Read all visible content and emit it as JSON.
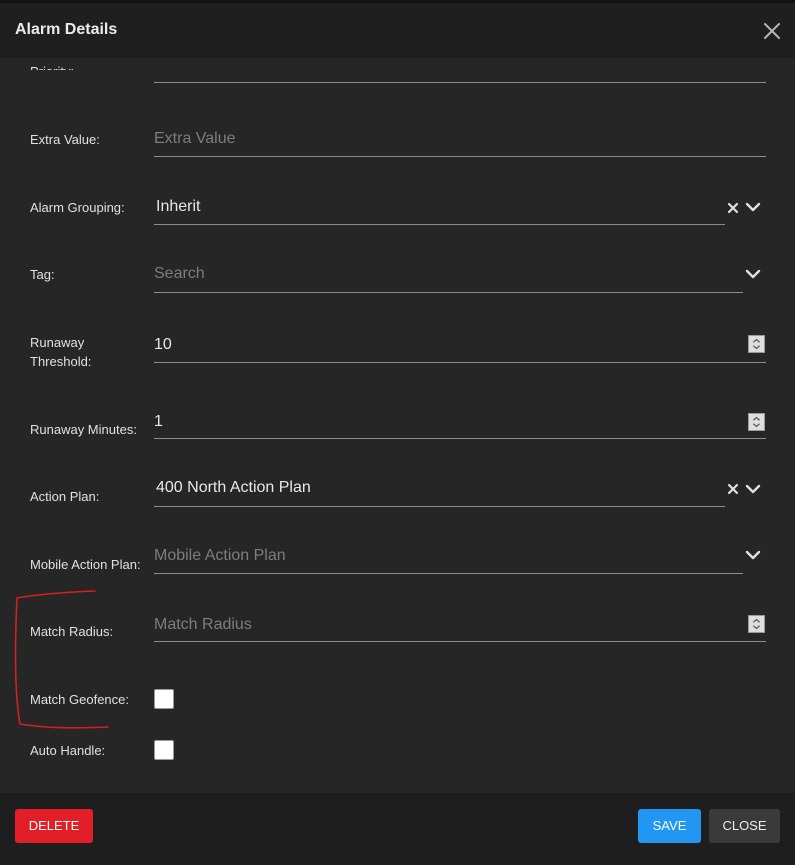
{
  "dialog": {
    "title": "Alarm Details",
    "partial_label": "Priority:"
  },
  "fields": {
    "extra_value": {
      "label": "Extra Value:",
      "placeholder": "Extra Value"
    },
    "alarm_grouping": {
      "label": "Alarm Grouping:",
      "value": "Inherit"
    },
    "tag": {
      "label": "Tag:",
      "placeholder": "Search"
    },
    "runaway_threshold": {
      "label_line1": "Runaway",
      "label_line2": "Threshold:",
      "value": "10"
    },
    "runaway_minutes": {
      "label": "Runaway Minutes:",
      "value": "1"
    },
    "action_plan": {
      "label": "Action Plan:",
      "value": "400 North Action Plan"
    },
    "mobile_action_plan": {
      "label": "Mobile Action Plan:",
      "placeholder": "Mobile Action Plan"
    },
    "match_radius": {
      "label": "Match Radius:",
      "placeholder": "Match Radius"
    },
    "match_geofence": {
      "label": "Match Geofence:",
      "checked": false
    },
    "auto_handle": {
      "label": "Auto Handle:",
      "checked": false
    }
  },
  "footer": {
    "delete_label": "DELETE",
    "save_label": "SAVE",
    "close_label": "CLOSE"
  },
  "colors": {
    "delete": "#e21e26",
    "save": "#2196f3",
    "annotation": "#d32020"
  },
  "icons": [
    "close-icon",
    "clear-icon",
    "chevron-down-icon",
    "spinner-icon"
  ]
}
